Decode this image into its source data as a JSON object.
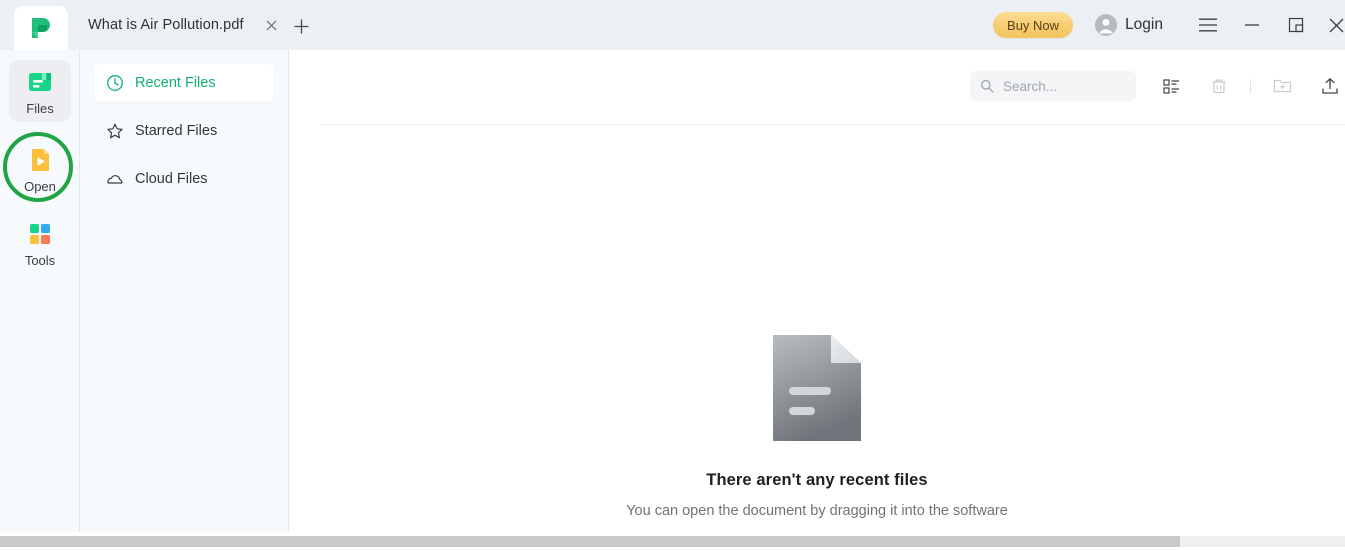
{
  "window": {
    "tab_title": "What is Air Pollution.pdf",
    "close_tab_icon": "close-icon",
    "new_tab_icon": "plus-icon",
    "logo_icon": "app-logo-leaf-icon",
    "buy_now_label": "Buy Now",
    "login_label": "Login",
    "avatar_icon": "user-avatar-icon",
    "menu_icon": "hamburger-menu-icon",
    "minimize_icon": "minimize-icon",
    "restore_icon": "restore-window-icon",
    "close_icon": "close-window-icon"
  },
  "rail": {
    "items": [
      {
        "label": "Files",
        "icon": "files-folder-icon",
        "active": true
      },
      {
        "label": "Open",
        "icon": "open-file-icon",
        "active": false
      },
      {
        "label": "Tools",
        "icon": "tools-grid-icon",
        "active": false
      }
    ],
    "highlight": {
      "target": "Open",
      "color": "#21a445"
    }
  },
  "nav": {
    "items": [
      {
        "label": "Recent Files",
        "icon": "clock-icon",
        "active": true
      },
      {
        "label": "Starred Files",
        "icon": "star-icon",
        "active": false
      },
      {
        "label": "Cloud Files",
        "icon": "cloud-icon",
        "active": false
      }
    ]
  },
  "toolbar": {
    "search_placeholder": "Search...",
    "search_value": "",
    "search_icon": "search-icon",
    "list_view_icon": "list-view-icon",
    "delete_icon": "trash-icon",
    "new_folder_icon": "new-folder-icon",
    "upload_icon": "upload-icon"
  },
  "empty_state": {
    "icon": "empty-document-icon",
    "title": "There aren't any recent files",
    "subtitle": "You can open the document by dragging it into the software"
  },
  "colors": {
    "accent_green": "#12b070",
    "highlight_green": "#21a445",
    "buy_now_gold": "#f3c45f",
    "titlebar_bg": "#eceff3",
    "panel_bg": "#f7fafd"
  }
}
